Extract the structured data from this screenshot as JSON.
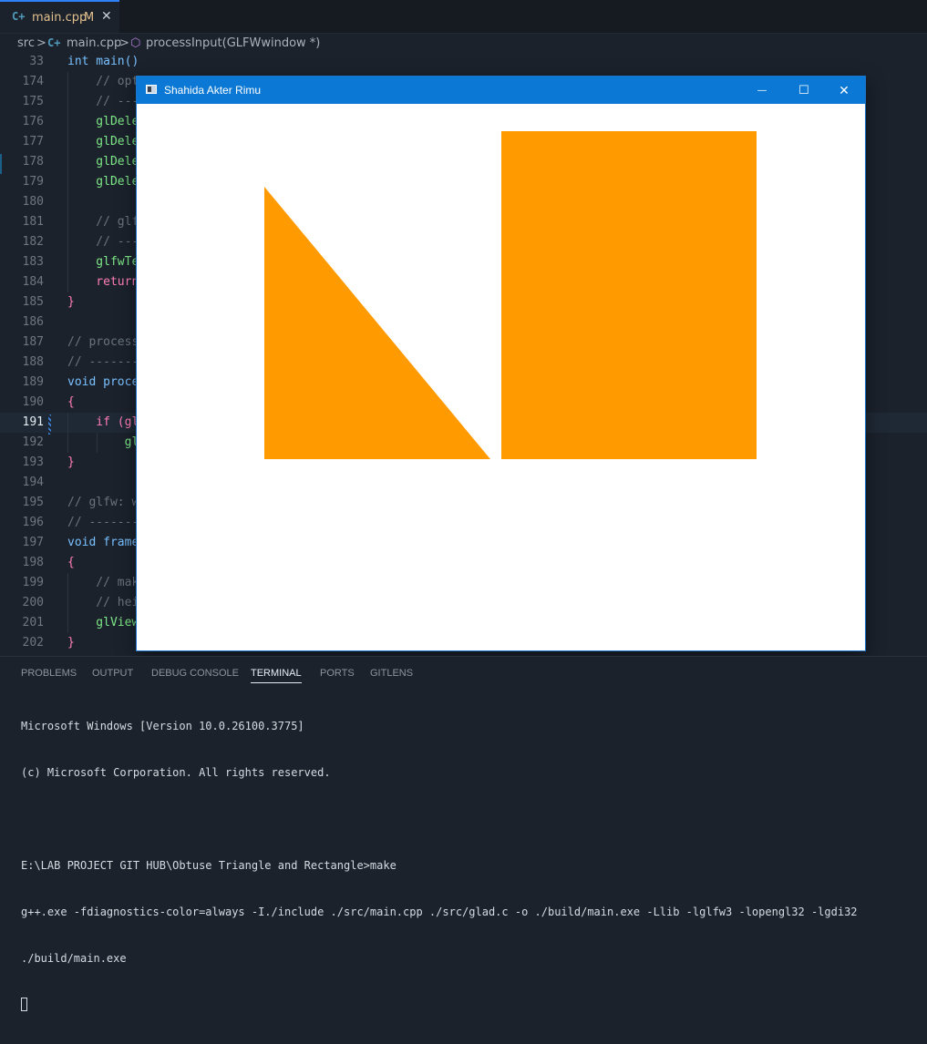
{
  "tab": {
    "icon": "cpp-icon",
    "name": "main.cpp",
    "modified": "M",
    "close": "✕"
  },
  "breadcrumb": {
    "folder": "src",
    "sep": ">",
    "file": "main.cpp",
    "symbol": "processInput(GLFWwindow *)"
  },
  "editor": {
    "lines": [
      {
        "num": "33",
        "code": "int main()"
      },
      {
        "num": "174",
        "code": "    // opt"
      },
      {
        "num": "175",
        "code": "    // ---"
      },
      {
        "num": "176",
        "code": "    glDele"
      },
      {
        "num": "177",
        "code": "    glDele"
      },
      {
        "num": "178",
        "code": "    glDele"
      },
      {
        "num": "179",
        "code": "    glDele"
      },
      {
        "num": "180",
        "code": ""
      },
      {
        "num": "181",
        "code": "    // glf"
      },
      {
        "num": "182",
        "code": "    // ---"
      },
      {
        "num": "183",
        "code": "    glfwTe"
      },
      {
        "num": "184",
        "code": "    return"
      },
      {
        "num": "185",
        "code": "}"
      },
      {
        "num": "186",
        "code": ""
      },
      {
        "num": "187",
        "code": "// process"
      },
      {
        "num": "188",
        "code": "// -------"
      },
      {
        "num": "189",
        "code": "void proce"
      },
      {
        "num": "190",
        "code": "{"
      },
      {
        "num": "191",
        "code": "    if (gl"
      },
      {
        "num": "192",
        "code": "        gl"
      },
      {
        "num": "193",
        "code": "}"
      },
      {
        "num": "194",
        "code": ""
      },
      {
        "num": "195",
        "code": "// glfw: w"
      },
      {
        "num": "196",
        "code": "// -------"
      },
      {
        "num": "197",
        "code": "void frame"
      },
      {
        "num": "198",
        "code": "{"
      },
      {
        "num": "199",
        "code": "    // mak"
      },
      {
        "num": "200",
        "code": "    // hei"
      },
      {
        "num": "201",
        "code": "    glView"
      },
      {
        "num": "202",
        "code": "}"
      }
    ]
  },
  "glwindow": {
    "title": "Shahida Akter Rimu",
    "icon": "app-window-icon",
    "minimize": "—",
    "maximize": "☐",
    "close": "✕",
    "fill_color": "#ff9a00",
    "background": "#ffffff"
  },
  "panel": {
    "tabs": [
      "PROBLEMS",
      "OUTPUT",
      "DEBUG CONSOLE",
      "TERMINAL",
      "PORTS",
      "GITLENS"
    ],
    "active_tab": "TERMINAL",
    "terminal_lines": [
      "Microsoft Windows [Version 10.0.26100.3775]",
      "(c) Microsoft Corporation. All rights reserved.",
      "",
      "E:\\LAB PROJECT GIT HUB\\Obtuse Triangle and Rectangle>make",
      "g++.exe -fdiagnostics-color=always -I./include ./src/main.cpp ./src/glad.c -o ./build/main.exe -Llib -lglfw3 -lopengl32 -lgdi32",
      "./build/main.exe"
    ]
  }
}
